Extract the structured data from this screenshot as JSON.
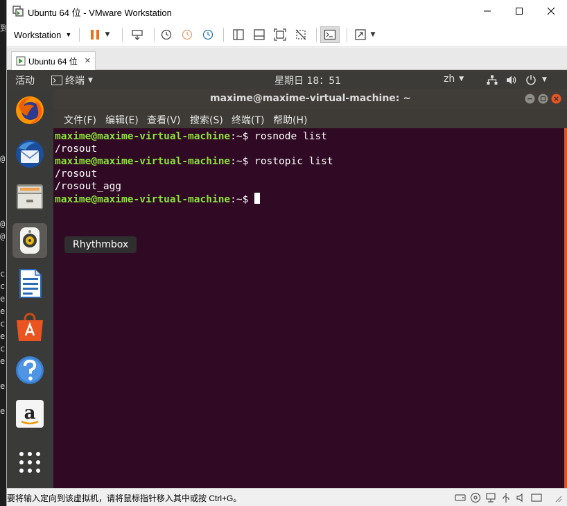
{
  "background_window": {
    "chars": [
      "到",
      "@",
      "@",
      "@",
      "c",
      "c",
      "e",
      "e",
      "c",
      "e",
      "c",
      "e",
      "e",
      "e"
    ]
  },
  "window": {
    "title": "Ubuntu 64 位 - VMware Workstation"
  },
  "toolbar": {
    "workstation_label": "Workstation"
  },
  "tab": {
    "label": "Ubuntu 64 位"
  },
  "gnome_topbar": {
    "activities": "活动",
    "app_menu": "终端",
    "clock": "星期日 18：51",
    "input_method": "zh"
  },
  "terminal": {
    "title": "maxime@maxime-virtual-machine: ~",
    "menu": [
      "文件(F)",
      "编辑(E)",
      "查看(V)",
      "搜索(S)",
      "终端(T)",
      "帮助(H)"
    ],
    "prompt": "maxime@maxime-virtual-machine",
    "prompt_suffix": ":~$ ",
    "lines": [
      {
        "type": "cmd",
        "text": "rosnode list"
      },
      {
        "type": "out",
        "text": "/rosout"
      },
      {
        "type": "cmd",
        "text": "rostopic list"
      },
      {
        "type": "out",
        "text": "/rosout"
      },
      {
        "type": "out",
        "text": "/rosout_agg"
      },
      {
        "type": "cmd",
        "text": ""
      }
    ]
  },
  "tooltip": {
    "label": "Rhythmbox"
  },
  "dock": {
    "items": [
      "firefox",
      "thunderbird",
      "files",
      "rhythmbox",
      "libreoffice-writer",
      "ubuntu-software",
      "help",
      "amazon",
      "show-applications"
    ]
  },
  "statusbar": {
    "text": "要将输入定向到该虚拟机，请将鼠标指针移入其中或按 Ctrl+G。"
  },
  "colors": {
    "terminal_bg": "#300a24",
    "prompt_green": "#8ae234",
    "ubuntu_orange": "#e95420",
    "toolbar_orange": "#f26b1d"
  }
}
